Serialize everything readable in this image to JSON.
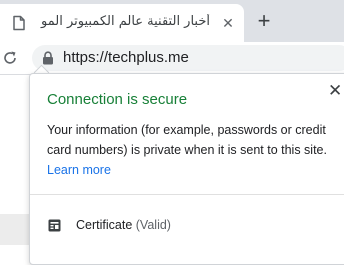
{
  "tab": {
    "title": "أخبار التقنية عالم الكمبيوتر الموبايل",
    "close_glyph": "✕"
  },
  "new_tab_glyph": "+",
  "address_bar": {
    "url": "https://techplus.me"
  },
  "security_bubble": {
    "title": "Connection is secure",
    "close_glyph": "✕",
    "description": "Your information (for example, passwords or credit card numbers) is private when it is sent to this site.",
    "learn_more": "Learn more",
    "certificate_label": "Certificate",
    "certificate_status": "(Valid)"
  },
  "colors": {
    "secure_green": "#188038",
    "link_blue": "#1a73e8",
    "tabstrip": "#dee1e6"
  }
}
